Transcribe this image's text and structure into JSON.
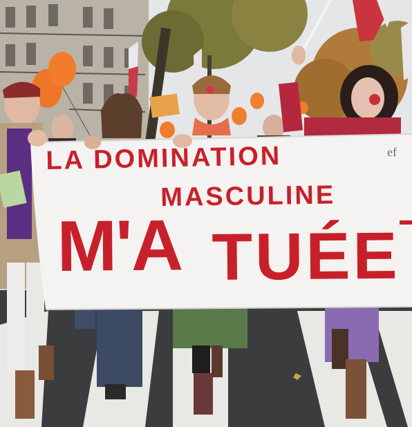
{
  "scene": {
    "description_tag": "",
    "colors": {
      "banner": "#f5f4f2",
      "banner_text": "#c8202a",
      "sky": "#e6e8ea",
      "road": "#3a3b3d",
      "crosswalk": "#e9e9e6",
      "balloon": "#f2782a"
    }
  },
  "banner": {
    "line1": "LA DOMINATION",
    "line2": "MASCULINE",
    "line3a": "M'A",
    "line3b": "TUÉE",
    "signature": "ef"
  },
  "sign_small": {
    "text": ""
  }
}
